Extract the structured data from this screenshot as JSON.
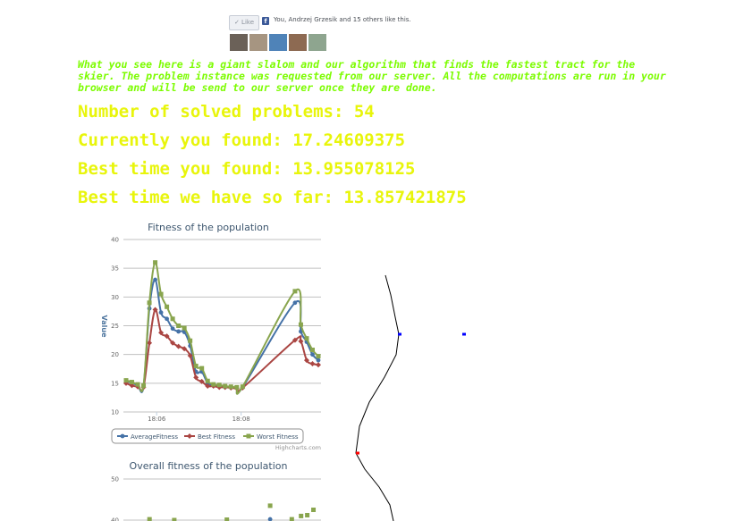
{
  "facebook": {
    "like_label": "✓ Like",
    "logo_letter": "f",
    "likes_text": "You, Andrzej Grzesik and 15 others like this.",
    "faces": [
      "#6b6158",
      "#a69581",
      "#4f83b8",
      "#8d6a52",
      "#8ea58f"
    ]
  },
  "intro_text": "What you see here is a giant slalom and our algorithm that finds the fastest tract for the skier. The problem instance was requested from our server. All the computations are run in your browser and will be send to our server once they are done.",
  "stats": {
    "solved": "Number of solved problems: 54",
    "current": "Currently you found: 17.24609375",
    "best_you": "Best time you found: 13.955078125",
    "best_all": "Best time we have so far: 13.857421875"
  },
  "colors": {
    "intro": "#7cfc00",
    "stats": "#e8f50b",
    "avg": "#4572a7",
    "best": "#aa4643",
    "worst": "#89a54e"
  },
  "chart_data": [
    {
      "type": "line",
      "title": "Fitness of the population",
      "ylabel": "Value",
      "ylim": [
        10,
        40
      ],
      "yticks": [
        "10",
        "15",
        "20",
        "25",
        "30",
        "35",
        "40"
      ],
      "xtick_labels": [
        "18:06",
        "18:08"
      ],
      "credits": "Highcharts.com",
      "x": [
        0,
        0.4,
        0.8,
        1.2,
        1.6,
        2.0,
        2.4,
        2.8,
        3.2,
        3.6,
        4.0,
        4.4,
        4.8,
        5.2,
        5.6,
        6.0,
        6.4,
        6.8,
        7.2,
        7.6,
        8.0,
        11.6,
        12.0,
        12.4,
        12.8,
        13.2
      ],
      "series": [
        {
          "name": "AverageFitness",
          "color": "#4572a7",
          "values": [
            15.3,
            15.1,
            14.6,
            14.4,
            28.0,
            33.0,
            27.3,
            26.2,
            24.5,
            24.0,
            23.9,
            21.5,
            17.0,
            17.0,
            15.0,
            14.6,
            14.5,
            14.3,
            14.3,
            14.2,
            14.3,
            29.0,
            24.0,
            22.2,
            20.0,
            19.0
          ]
        },
        {
          "name": "Best Fitness",
          "color": "#aa4643",
          "values": [
            15.0,
            14.6,
            14.4,
            14.3,
            22.0,
            27.8,
            23.8,
            23.2,
            22.0,
            21.4,
            21.0,
            19.8,
            16.0,
            15.3,
            14.5,
            14.5,
            14.3,
            14.3,
            14.2,
            14.1,
            14.2,
            22.5,
            22.3,
            19.0,
            18.4,
            18.2
          ]
        },
        {
          "name": "Worst Fitness",
          "color": "#89a54e",
          "values": [
            15.5,
            15.2,
            14.8,
            14.6,
            29.0,
            36.0,
            30.5,
            28.3,
            26.2,
            25.0,
            24.6,
            22.4,
            18.0,
            17.6,
            15.4,
            14.8,
            14.7,
            14.5,
            14.4,
            14.3,
            14.4,
            31.0,
            25.2,
            22.8,
            20.8,
            19.7
          ]
        }
      ]
    },
    {
      "type": "scatter",
      "title": "Overall fitness of the population",
      "ylim": [
        40,
        50
      ],
      "yticks": [
        "40",
        "50"
      ],
      "series": [
        {
          "name": "Worst Fitness",
          "color": "#89a54e",
          "x": [
            0.7,
            1.5,
            3.2,
            4.6,
            5.3,
            5.6,
            5.8,
            6.0
          ],
          "values": [
            40.2,
            40.0,
            40.1,
            43.5,
            40.2,
            41.0,
            41.2,
            42.5
          ]
        },
        {
          "name": "AverageFitness",
          "color": "#4572a7",
          "x": [
            4.6
          ],
          "values": [
            40.2
          ]
        }
      ]
    }
  ],
  "slalom": {
    "path_color": "#000000",
    "path": [
      [
        51,
        8
      ],
      [
        57,
        30
      ],
      [
        62,
        55
      ],
      [
        66,
        74
      ],
      [
        63,
        97
      ],
      [
        50,
        122
      ],
      [
        33,
        150
      ],
      [
        22,
        177
      ],
      [
        18,
        207
      ],
      [
        28,
        225
      ],
      [
        44,
        245
      ],
      [
        56,
        265
      ],
      [
        60,
        283
      ]
    ],
    "gates": [
      {
        "x": 67,
        "y": 74,
        "color": "#0000ff"
      },
      {
        "x": 139,
        "y": 74,
        "color": "#0000ff"
      },
      {
        "x": 20,
        "y": 207,
        "color": "#ff0000"
      }
    ]
  }
}
